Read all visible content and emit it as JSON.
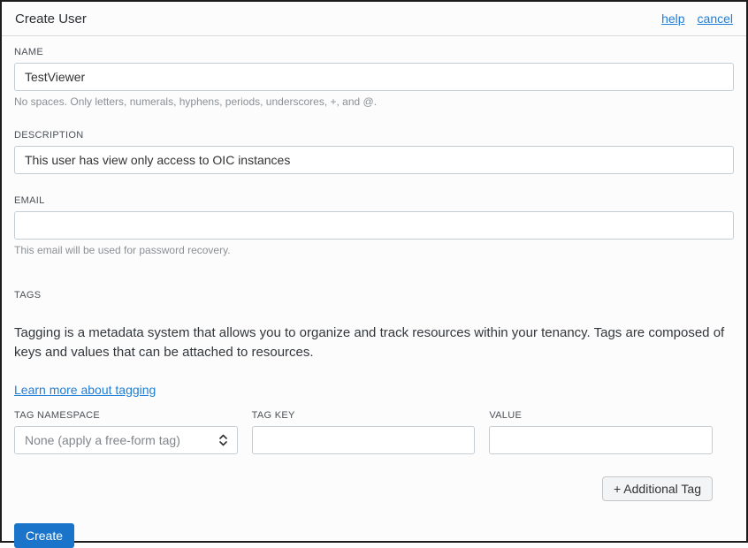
{
  "header": {
    "title": "Create User",
    "help_label": "help",
    "cancel_label": "cancel"
  },
  "form": {
    "name": {
      "label": "NAME",
      "value": "TestViewer",
      "helper": "No spaces. Only letters, numerals, hyphens, periods, underscores, +, and @."
    },
    "description": {
      "label": "DESCRIPTION",
      "value": "This user has view only access to OIC instances"
    },
    "email": {
      "label": "EMAIL",
      "value": "",
      "helper": "This email will be used for password recovery."
    }
  },
  "tags": {
    "section_label": "TAGS",
    "intro": "Tagging is a metadata system that allows you to organize and track resources within your tenancy. Tags are composed of keys and values that can be attached to resources.",
    "learn_more_label": "Learn more about tagging",
    "namespace": {
      "label": "TAG NAMESPACE",
      "selected_option": "None (apply a free-form tag)"
    },
    "key": {
      "label": "TAG KEY",
      "value": ""
    },
    "value": {
      "label": "VALUE",
      "value": ""
    },
    "additional_tag_label": "+ Additional Tag"
  },
  "footer": {
    "create_label": "Create"
  },
  "icons": {
    "select_spinner": "select-spinner-icon"
  },
  "colors": {
    "primary_button_blue": "#1a74c9",
    "link_blue": "#1f7ed6",
    "input_border": "#c5cdd4",
    "helper_gray": "#8b9096"
  }
}
